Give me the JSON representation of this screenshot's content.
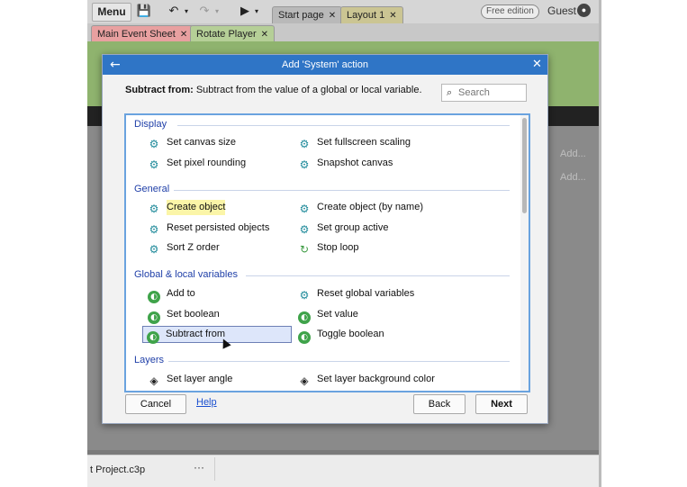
{
  "toolbar": {
    "menu_label": "Menu",
    "tabs": [
      {
        "label": "Start page",
        "close": "✕"
      },
      {
        "label": "Layout 1",
        "close": "✕"
      }
    ],
    "free_badge": "Free edition",
    "user_label": "Guest"
  },
  "editor_tabs": [
    {
      "label": "Main Event Sheet",
      "close": "✕"
    },
    {
      "label": "Rotate Player",
      "close": "✕"
    }
  ],
  "background": {
    "add_labels": [
      "Add...",
      "Add..."
    ]
  },
  "dialog": {
    "title": "Add 'System' action",
    "description_bold": "Subtract from:",
    "description_text": " Subtract from the value of a global or local variable.",
    "search_placeholder": "Search",
    "categories": [
      {
        "name": "Display",
        "items": [
          {
            "label": "Set canvas size",
            "icon": "gear-icon"
          },
          {
            "label": "Set fullscreen scaling",
            "icon": "gear-icon"
          },
          {
            "label": "Set pixel rounding",
            "icon": "gear-icon"
          },
          {
            "label": "Snapshot canvas",
            "icon": "gear-icon"
          }
        ]
      },
      {
        "name": "General",
        "items": [
          {
            "label": "Create object",
            "icon": "gear-icon"
          },
          {
            "label": "Create object (by name)",
            "icon": "gear-icon"
          },
          {
            "label": "Reset persisted objects",
            "icon": "gear-icon"
          },
          {
            "label": "Set group active",
            "icon": "gear-icon"
          },
          {
            "label": "Sort Z order",
            "icon": "gear-icon"
          },
          {
            "label": "Stop loop",
            "icon": "loop-icon"
          }
        ]
      },
      {
        "name": "Global & local variables",
        "items": [
          {
            "label": "Add to",
            "icon": "globe-icon"
          },
          {
            "label": "Reset global variables",
            "icon": "gear-icon"
          },
          {
            "label": "Set boolean",
            "icon": "globe-icon"
          },
          {
            "label": "Set value",
            "icon": "globe-icon"
          },
          {
            "label": "Subtract from",
            "icon": "globe-icon"
          },
          {
            "label": "Toggle boolean",
            "icon": "globe-icon"
          }
        ]
      },
      {
        "name": "Layers",
        "items": [
          {
            "label": "Set layer angle",
            "icon": "layers-icon"
          },
          {
            "label": "Set layer background color",
            "icon": "layers-icon"
          }
        ]
      }
    ],
    "highlighted_item": "Create object",
    "selected_item": "Subtract from",
    "buttons": {
      "cancel": "Cancel",
      "help": "Help",
      "back": "Back",
      "next": "Next"
    }
  },
  "bottom_bar": {
    "project_name": "t Project.c3p",
    "more": "···"
  },
  "colors": {
    "title_bar": "#2f75c6",
    "category_text": "#1f3fa8",
    "selection_bg": "#dde6fa",
    "highlight_bg": "#fbf5a8",
    "gear_icon": "#1f8a9a",
    "globe_icon": "#3fa34a"
  }
}
